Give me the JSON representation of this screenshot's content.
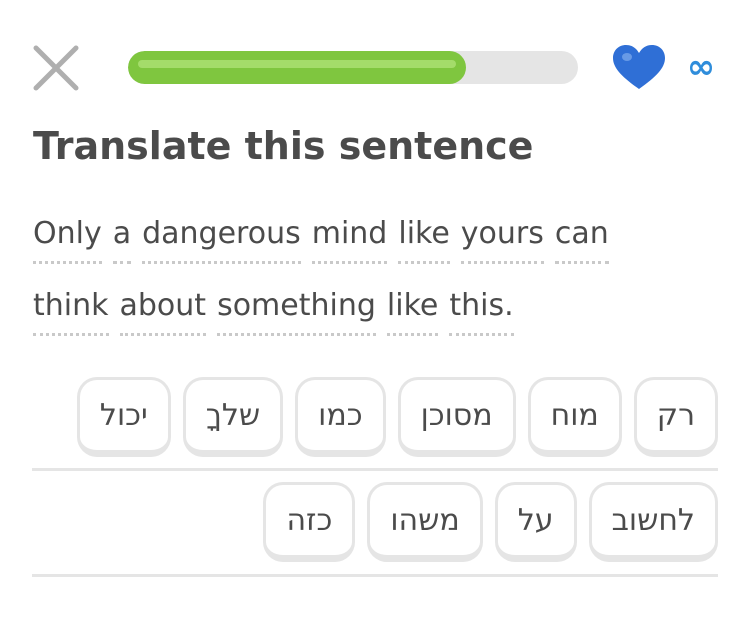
{
  "header": {
    "close_icon": "close-x-icon",
    "progress": 0.75,
    "hearts_icon": "heart-icon",
    "hearts_value": "∞",
    "accent_green": "#7fc63f",
    "heart_color": "#2f6fd6",
    "infinity_color": "#2f8ddb"
  },
  "challenge": {
    "title": "Translate this sentence",
    "sentence_lines": [
      [
        "Only",
        "a",
        "dangerous",
        "mind",
        "like",
        "yours",
        "can"
      ],
      [
        "think",
        "about",
        "something",
        "like",
        "this."
      ]
    ]
  },
  "word_bank": {
    "rows": [
      [
        "רק",
        "מוח",
        "מסוכן",
        "כמו",
        "שלךָ",
        "יכול"
      ],
      [
        "לחשוב",
        "על",
        "משהו",
        "כזה"
      ]
    ]
  }
}
